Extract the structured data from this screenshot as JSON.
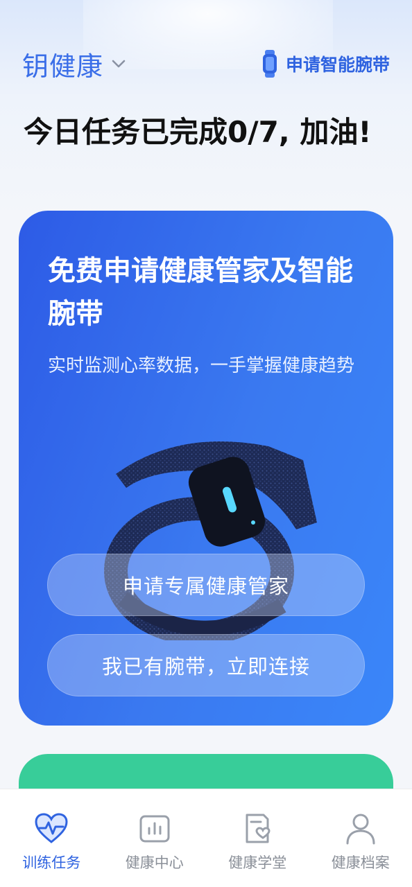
{
  "header": {
    "brand": "钥健康",
    "apply_link": "申请智能腕带"
  },
  "task_title": "今日任务已完成0/7, 加油!",
  "promo_card": {
    "title": "免费申请健康管家及智能腕带",
    "subtitle": "实时监测心率数据，一手掌握健康趋势",
    "primary_button": "申请专属健康管家",
    "secondary_button": "我已有腕带，立即连接"
  },
  "tabs": [
    {
      "label": "训练任务",
      "icon": "heart-pulse-icon",
      "active": true
    },
    {
      "label": "健康中心",
      "icon": "chart-icon",
      "active": false
    },
    {
      "label": "健康学堂",
      "icon": "document-heart-icon",
      "active": false
    },
    {
      "label": "健康档案",
      "icon": "person-icon",
      "active": false
    }
  ],
  "colors": {
    "accent": "#2f63e0",
    "card_gradient_start": "#2d5be6",
    "card_gradient_end": "#3a86f9",
    "green_card": "#38cd99"
  }
}
